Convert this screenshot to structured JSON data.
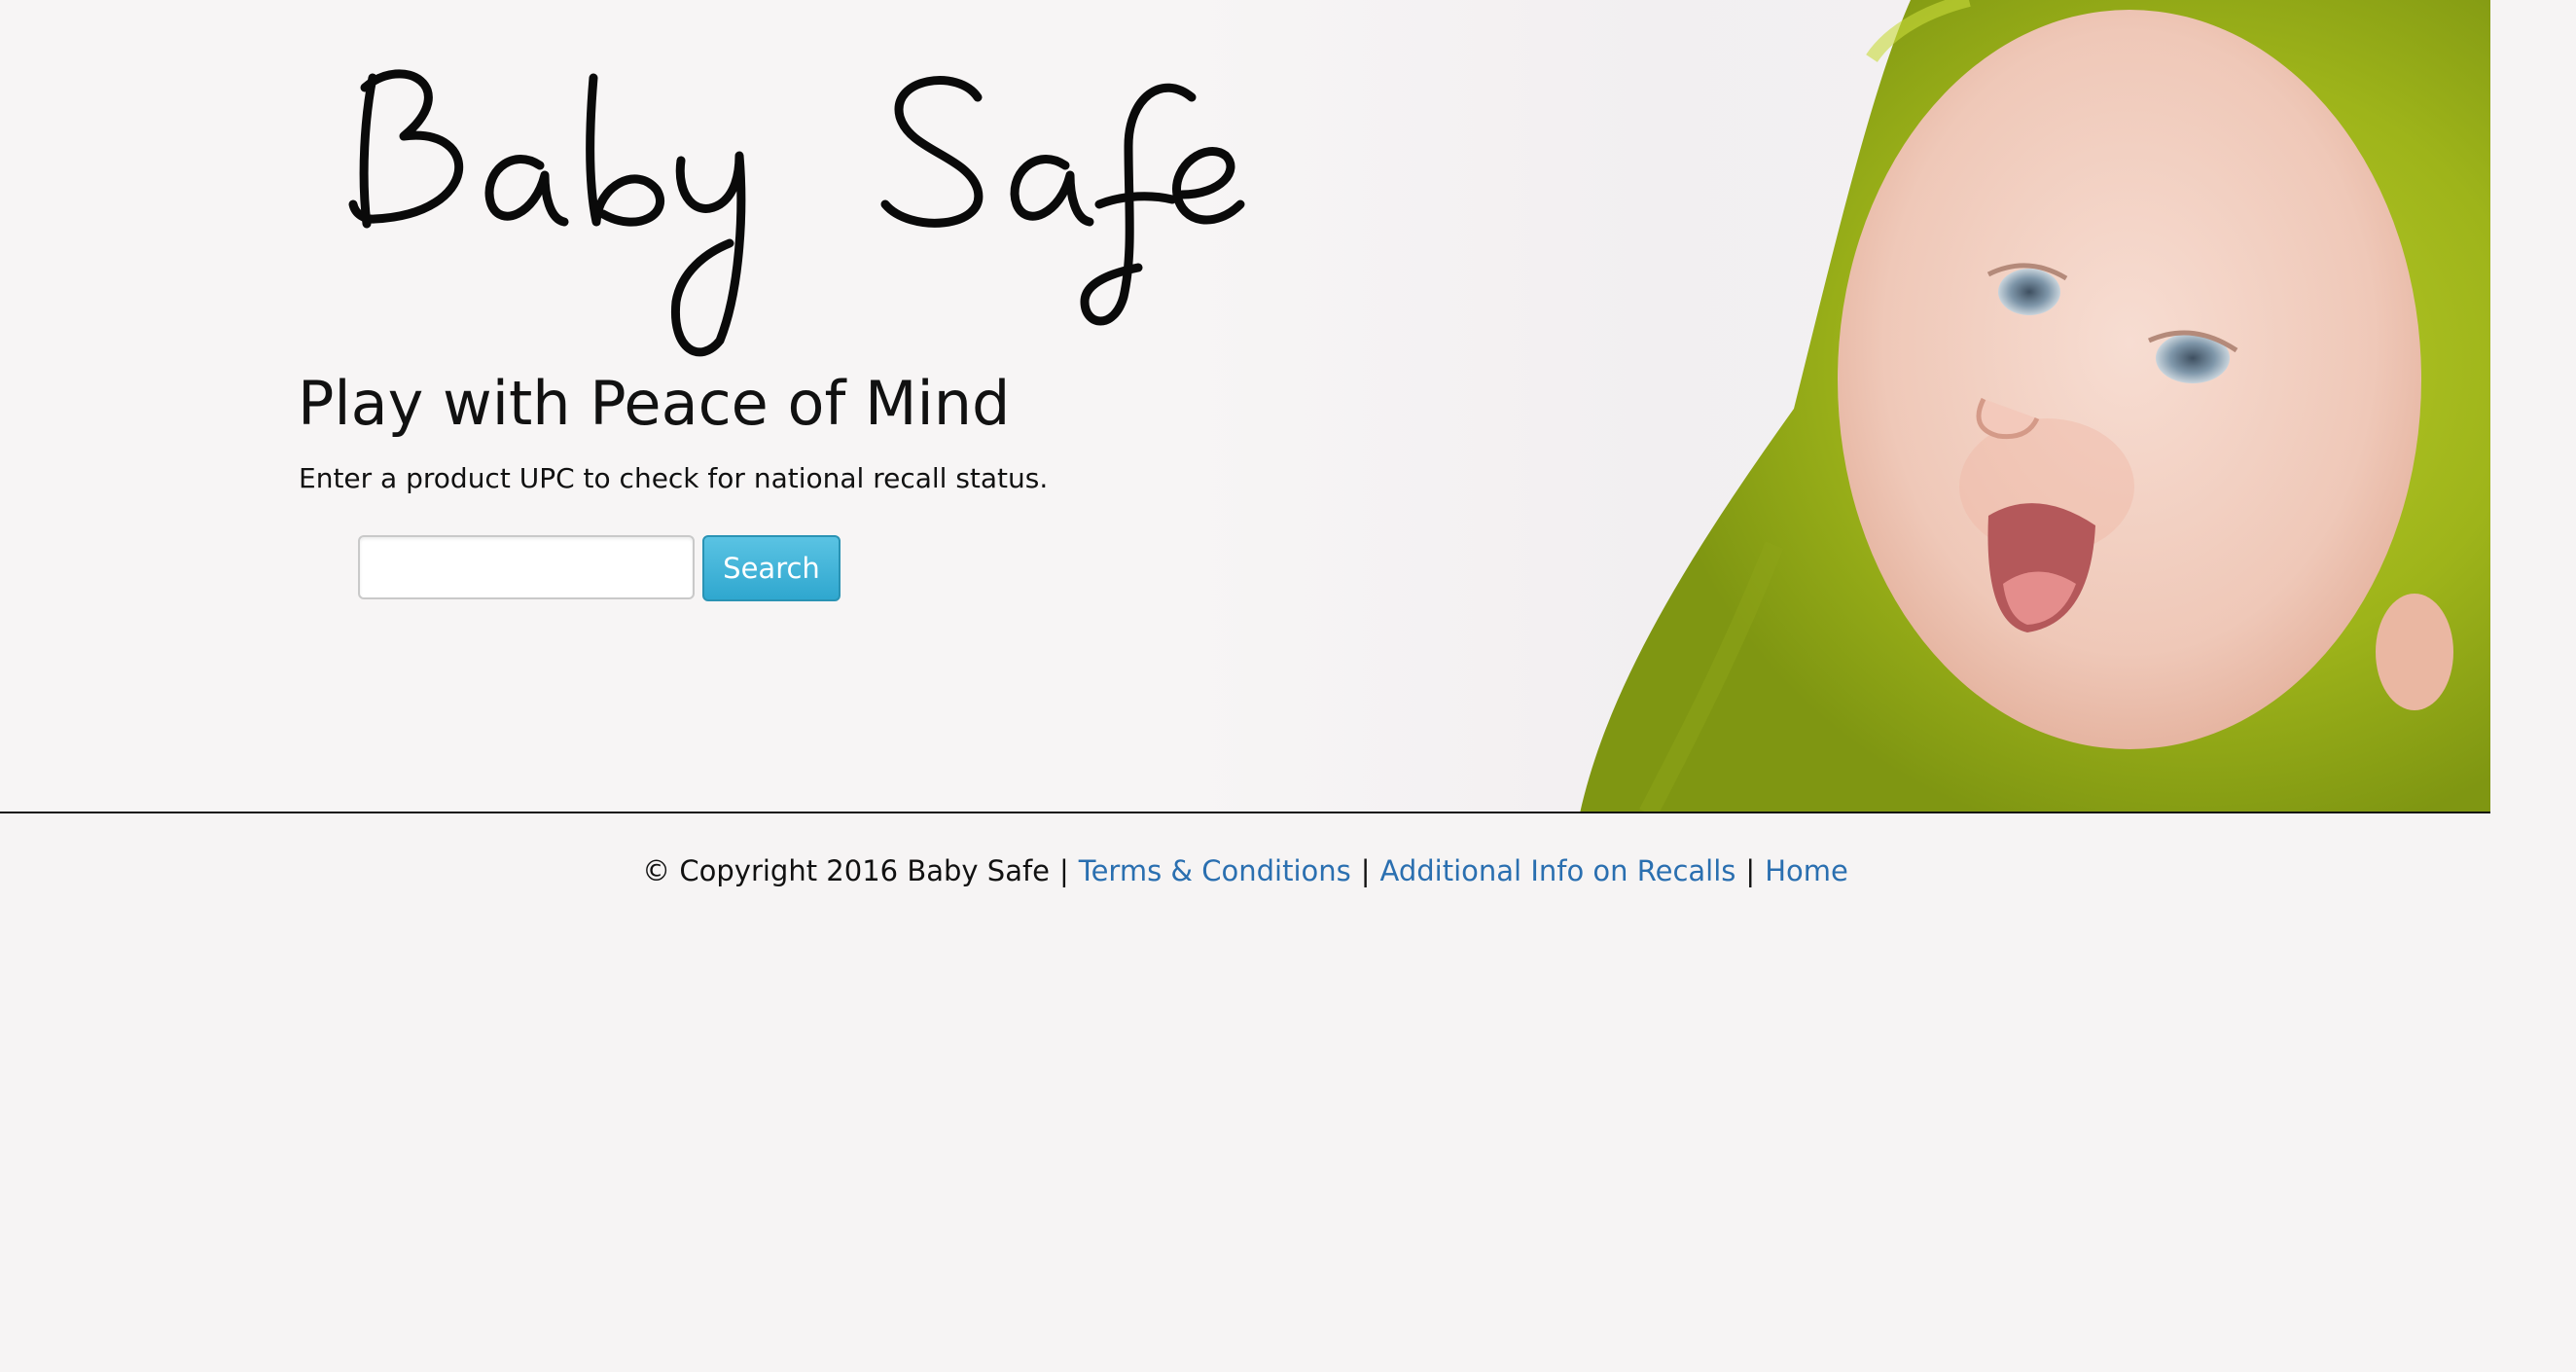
{
  "brand": {
    "logo_text": "Baby Safe"
  },
  "hero": {
    "tagline": "Play with Peace of Mind",
    "instructions": "Enter a product UPC to check for national recall status.",
    "search": {
      "value": "",
      "placeholder": "",
      "button_label": "Search"
    },
    "photo": "smiling baby in green hooded towel"
  },
  "footer": {
    "copyright": "© Copyright 2016 Baby Safe",
    "separator": "|",
    "links": [
      {
        "label": "Terms & Conditions"
      },
      {
        "label": "Additional Info on Recalls"
      },
      {
        "label": "Home"
      }
    ]
  },
  "colors": {
    "background": "#f6f4f4",
    "button": "#3ab0d8",
    "link": "#2a6fb0",
    "text": "#111111"
  }
}
